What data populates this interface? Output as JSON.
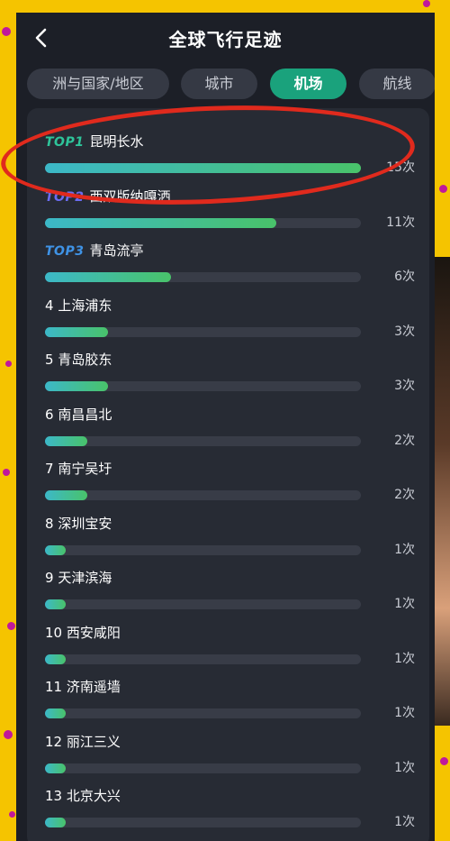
{
  "header": {
    "title": "全球飞行足迹",
    "back_icon": "chevron-left-icon"
  },
  "tabs": [
    {
      "label": "洲与国家/地区",
      "active": false
    },
    {
      "label": "城市",
      "active": false
    },
    {
      "label": "机场",
      "active": true
    },
    {
      "label": "航线",
      "active": false
    }
  ],
  "airports": [
    {
      "rank": "1",
      "top_label": "TOP1",
      "top_color": "#2ec49a",
      "name": "昆明长水",
      "value": 15,
      "count": "15次"
    },
    {
      "rank": "2",
      "top_label": "TOP2",
      "top_color": "#6a6cf0",
      "name": "西双版纳嘎洒",
      "value": 11,
      "count": "11次"
    },
    {
      "rank": "3",
      "top_label": "TOP3",
      "top_color": "#3f93e6",
      "name": "青岛流亭",
      "value": 6,
      "count": "6次"
    },
    {
      "rank": "4",
      "name": "上海浦东",
      "value": 3,
      "count": "3次"
    },
    {
      "rank": "5",
      "name": "青岛胶东",
      "value": 3,
      "count": "3次"
    },
    {
      "rank": "6",
      "name": "南昌昌北",
      "value": 2,
      "count": "2次"
    },
    {
      "rank": "7",
      "name": "南宁吴圩",
      "value": 2,
      "count": "2次"
    },
    {
      "rank": "8",
      "name": "深圳宝安",
      "value": 1,
      "count": "1次"
    },
    {
      "rank": "9",
      "name": "天津滨海",
      "value": 1,
      "count": "1次"
    },
    {
      "rank": "10",
      "name": "西安咸阳",
      "value": 1,
      "count": "1次"
    },
    {
      "rank": "11",
      "name": "济南遥墙",
      "value": 1,
      "count": "1次"
    },
    {
      "rank": "12",
      "name": "丽江三义",
      "value": 1,
      "count": "1次"
    },
    {
      "rank": "13",
      "name": "北京大兴",
      "value": 1,
      "count": "1次"
    }
  ],
  "max_value": 15,
  "colors": {
    "accent": "#1aa27c",
    "annotation": "#e02a1d",
    "frame": "#f5c400"
  }
}
